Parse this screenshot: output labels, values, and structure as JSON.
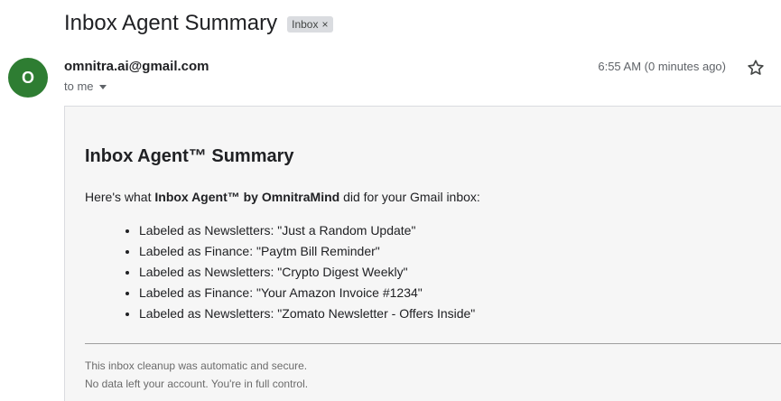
{
  "subject": "Inbox Agent Summary",
  "label_chip": {
    "label": "Inbox",
    "close": "×"
  },
  "sender": {
    "avatar_letter": "O",
    "avatar_color": "#2e7d32",
    "email": "omnitra.ai@gmail.com",
    "recipient": "to me"
  },
  "timestamp": "6:55 AM (0 minutes ago)",
  "body": {
    "title": "Inbox Agent™ Summary",
    "intro_prefix": "Here's what ",
    "intro_bold": "Inbox Agent™ by OmnitraMind",
    "intro_suffix": " did for your Gmail inbox:",
    "items": [
      "Labeled as Newsletters: \"Just a Random Update\"",
      "Labeled as Finance: \"Paytm Bill Reminder\"",
      "Labeled as Newsletters: \"Crypto Digest Weekly\"",
      "Labeled as Finance: \"Your Amazon Invoice #1234\"",
      "Labeled as Newsletters: \"Zomato Newsletter - Offers Inside\""
    ],
    "footer_line1": "This inbox cleanup was automatic and secure.",
    "footer_line2": "No data left your account. You're in full control."
  },
  "icons": {
    "star": "star-icon",
    "dropdown": "chevron-down-icon",
    "chip_close": "close-icon"
  }
}
